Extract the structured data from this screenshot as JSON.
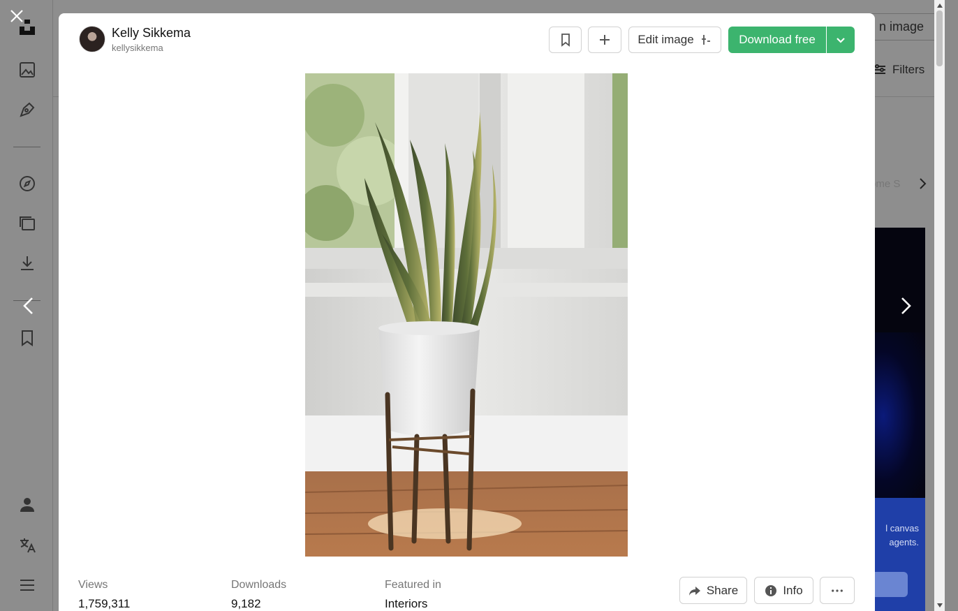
{
  "background": {
    "search_image_label": "n image",
    "filters_label": "Filters",
    "chip_label": "ome S",
    "ad_text_line1": "l canvas",
    "ad_text_line2": "agents."
  },
  "modal": {
    "author": {
      "name": "Kelly Sikkema",
      "handle": "kellysikkema"
    },
    "toolbar": {
      "bookmark_icon": "bookmark-icon",
      "add_icon": "plus-icon",
      "edit_label": "Edit image",
      "download_label": "Download free"
    },
    "stats": [
      {
        "label": "Views",
        "value": "1,759,311"
      },
      {
        "label": "Downloads",
        "value": "9,182"
      },
      {
        "label": "Featured in",
        "value": "Interiors"
      }
    ],
    "actions": {
      "share_label": "Share",
      "info_label": "Info"
    }
  },
  "colors": {
    "accent": "#3cb46e",
    "overlay": "#8a8a8a"
  }
}
